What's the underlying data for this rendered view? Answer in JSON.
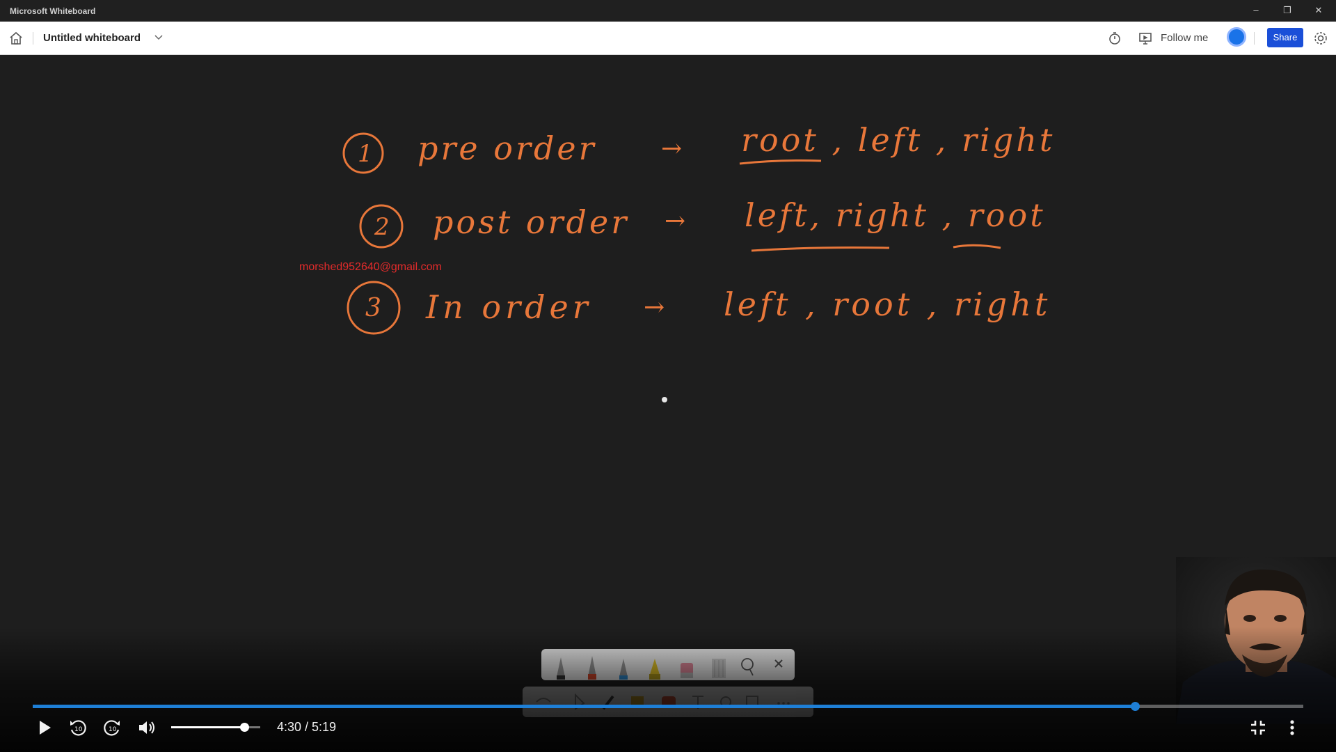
{
  "window": {
    "title": "Microsoft Whiteboard",
    "minimize_glyph": "–",
    "restore_glyph": "❐",
    "close_glyph": "✕"
  },
  "toolbar": {
    "home_icon": "home-icon",
    "board_title": "Untitled whiteboard",
    "follow_me": "Follow me",
    "share": "Share"
  },
  "canvas": {
    "watermark": "morshed952640@gmail.com",
    "lines": [
      {
        "number": "1",
        "term": "pre order",
        "rule": "root , left , right"
      },
      {
        "number": "2",
        "term": "post order",
        "rule": "left, right , root"
      },
      {
        "number": "3",
        "term": "In order",
        "rule": "left , root , right"
      }
    ],
    "ink_color": "#e8773a"
  },
  "player": {
    "time": "4:30 / 5:19",
    "progress": 0.8672,
    "volume": 0.82,
    "accent": "#1e7fd6"
  }
}
